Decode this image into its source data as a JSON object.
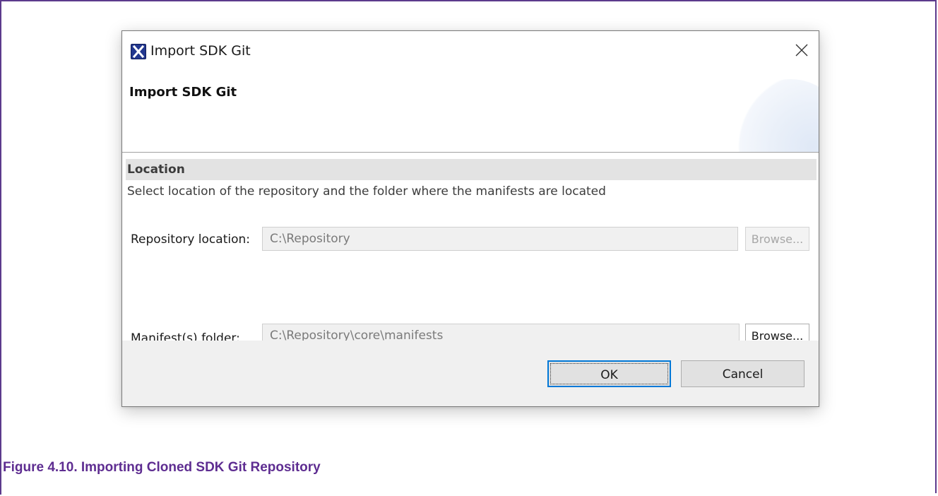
{
  "dialog": {
    "window_title": "Import SDK Git",
    "app_icon": "x-app-icon",
    "close_icon": "close-icon",
    "header_title": "Import SDK Git"
  },
  "section": {
    "title": "Location",
    "description": "Select location of the repository and the folder where the manifests are located"
  },
  "fields": {
    "repository": {
      "label": "Repository location:",
      "value": "C:\\Repository",
      "browse_label": "Browse...",
      "browse_enabled": false
    },
    "manifests": {
      "label": "Manifest(s) folder:",
      "value": "C:\\Repository\\core\\manifests",
      "browse_label": "Browse...",
      "browse_enabled": true
    }
  },
  "buttons": {
    "ok_label": "OK",
    "cancel_label": "Cancel"
  },
  "caption": "Figure 4.10. Importing Cloned SDK Git Repository",
  "colors": {
    "caption": "#5e2d91",
    "frame_border": "#5c3a8c",
    "focus_border": "#0078d7",
    "app_icon_bg": "#23388f"
  }
}
